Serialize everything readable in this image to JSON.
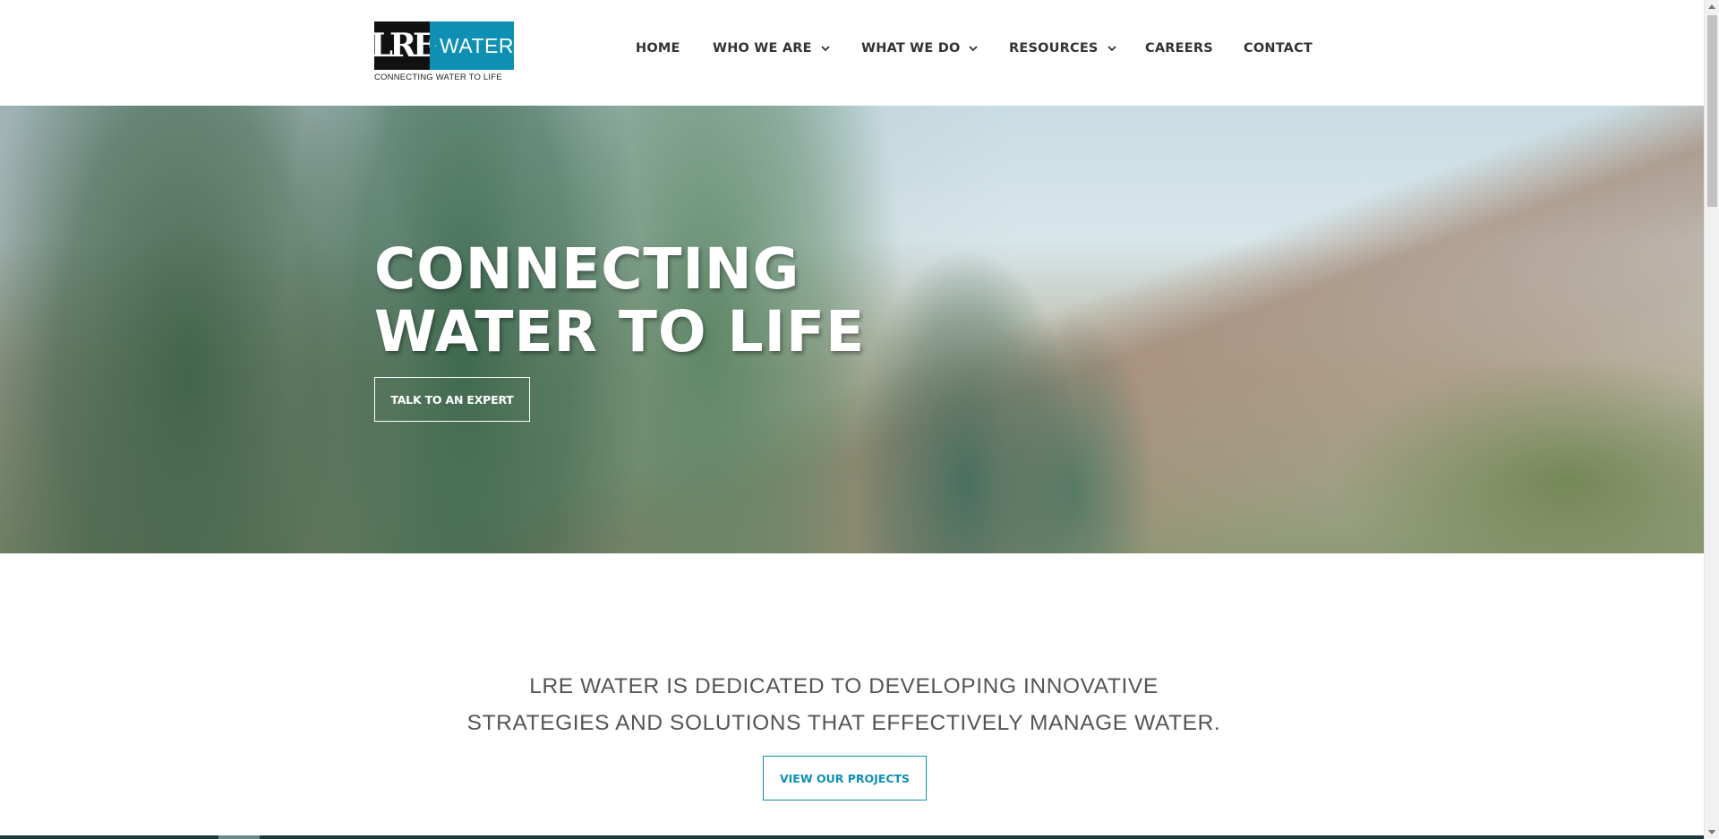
{
  "brand": {
    "logo_left": "LRE",
    "logo_right": "WATER",
    "tagline": "CONNECTING WATER TO LIFE",
    "accent_color": "#0e8fb4"
  },
  "nav": {
    "items": [
      {
        "label": "HOME",
        "has_dropdown": false
      },
      {
        "label": "WHO WE ARE",
        "has_dropdown": true
      },
      {
        "label": "WHAT WE DO",
        "has_dropdown": true
      },
      {
        "label": "RESOURCES",
        "has_dropdown": true
      },
      {
        "label": "CAREERS",
        "has_dropdown": false
      },
      {
        "label": "CONTACT",
        "has_dropdown": false
      }
    ]
  },
  "hero": {
    "title_line1": "CONNECTING",
    "title_line2": "WATER TO LIFE",
    "cta_label": "TALK TO AN EXPERT"
  },
  "intro": {
    "line1": "LRE WATER IS DEDICATED TO DEVELOPING INNOVATIVE",
    "line2": "STRATEGIES AND SOLUTIONS THAT EFFECTIVELY MANAGE WATER.",
    "cta_label": "VIEW OUR PROJECTS"
  }
}
